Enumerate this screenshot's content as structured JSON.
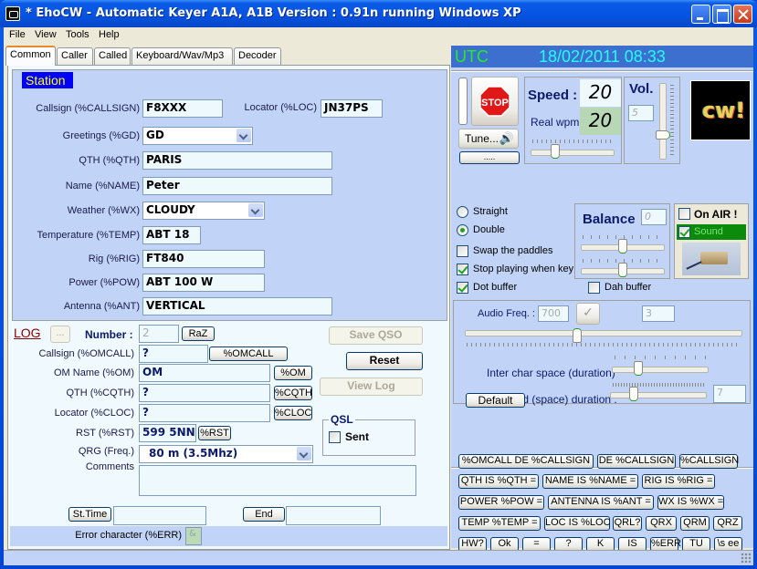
{
  "window": {
    "title": "* EhoCW - Automatic Keyer  A1A, A1B Version : 0.91n  running Windows XP"
  },
  "menu": [
    "File",
    "View",
    "Tools",
    "Help"
  ],
  "tabs": [
    {
      "label": "Common",
      "active": true
    },
    {
      "label": "Caller",
      "active": false
    },
    {
      "label": "Called",
      "active": false
    },
    {
      "label": "Keyboard/Wav/Mp3",
      "active": false
    },
    {
      "label": "Decoder",
      "active": false
    }
  ],
  "station": {
    "title": "Station",
    "callsign": {
      "label": "Callsign (%CALLSIGN)",
      "value": "F8XXX"
    },
    "locator": {
      "label": "Locator (%LOC)",
      "value": "JN37PS"
    },
    "greetings": {
      "label": "Greetings (%GD)",
      "value": "GD"
    },
    "qth": {
      "label": "QTH (%QTH)",
      "value": "PARIS"
    },
    "name": {
      "label": "Name (%NAME)",
      "value": "Peter"
    },
    "weather": {
      "label": "Weather (%WX)",
      "value": "CLOUDY"
    },
    "temperature": {
      "label": "Temperature (%TEMP)",
      "value": "ABT 18"
    },
    "rig": {
      "label": "Rig (%RIG)",
      "value": "FT840"
    },
    "power": {
      "label": "Power (%POW)",
      "value": "ABT 100 W"
    },
    "antenna": {
      "label": "Antenna (%ANT)",
      "value": "VERTICAL"
    }
  },
  "log": {
    "title": "LOG",
    "browse_label": "...",
    "number_label": "Number :",
    "number_value": "2",
    "raz_label": "RaZ",
    "save_qso": "Save QSO",
    "reset": "Reset",
    "view_log": "View Log",
    "callsign": {
      "label": "Callsign  (%OMCALL)",
      "value": "?",
      "button": "%OMCALL"
    },
    "om_name": {
      "label": "OM Name (%OM)",
      "value": "OM",
      "button": "%OM"
    },
    "qth": {
      "label": "QTH (%CQTH)",
      "value": "?",
      "button": "%CQTH"
    },
    "locator": {
      "label": "Locator (%CLOC)",
      "value": "?",
      "button": "%CLOC"
    },
    "rst": {
      "label": "RST (%RST)",
      "value": "599 5NN",
      "button": "%RST"
    },
    "qrg": {
      "label": "QRG (Freq.)",
      "value": "80 m (3.5Mhz)"
    },
    "comments": {
      "label": "Comments",
      "value": ""
    },
    "qsl": {
      "title": "QSL",
      "sent_label": "Sent",
      "sent": false
    },
    "start_time_button": "St.Time",
    "start_time_value": "",
    "end_button": "End",
    "end_value": "",
    "error_char": {
      "label": "Error character (%ERR)",
      "value": "&"
    }
  },
  "clock": {
    "label": "UTC",
    "datetime": "18/02/2011 08:33"
  },
  "keyer": {
    "stop_label": "STOP",
    "tune_label": "Tune...",
    "dots_label": ".....",
    "speed_label": "Speed :",
    "speed_value": "20",
    "real_wpm_label": "Real wpm:",
    "real_wpm_value": "20",
    "speed_slider_fraction": 0.27,
    "vol_label": "Vol.",
    "vol_value": "5",
    "vol_slider_fraction": 0.3,
    "logo_text": "cw!"
  },
  "paddles": {
    "straight_label": "Straight",
    "straight": false,
    "double_label": "Double",
    "double": true,
    "swap_label": "Swap the paddles",
    "swap": false,
    "stop_playing_label": "Stop playing when key",
    "stop_playing": true,
    "dot_buffer_label": "Dot buffer",
    "dot_buffer": true,
    "dah_buffer_label": "Dah buffer",
    "dah_buffer": false
  },
  "balance": {
    "label": "Balance",
    "value": "0",
    "slider1_fraction": 0.5,
    "slider2_fraction": 0.5
  },
  "onair": {
    "on_air_label": "On AIR !",
    "on_air": false,
    "sound_label": "Sound",
    "sound": true
  },
  "audio": {
    "freq_label": "Audio Freq. :",
    "freq_value": "700",
    "extra_value": "3",
    "freq_slider_fraction": 0.4,
    "inter_char_label": "Inter char space (duration)",
    "inter_char_fraction": 0.25,
    "inter_word_label": "Inter-word (space) duration :",
    "inter_word_fraction": 0.22,
    "inter_word_value": "7",
    "default_label": "Default"
  },
  "macros": [
    [
      "%OMCALL DE %CALLSIGN",
      "DE %CALLSIGN",
      "%CALLSIGN"
    ],
    [
      "QTH IS %QTH =",
      "NAME IS %NAME =",
      "RIG IS %RIG ="
    ],
    [
      "POWER %POW =",
      "ANTENNA IS %ANT =",
      "WX IS %WX ="
    ],
    [
      "TEMP %TEMP =",
      "LOC IS %LOC",
      "QRL?",
      "QRX",
      "QRM",
      "QRZ"
    ],
    [
      "HW?",
      "Ok",
      "=",
      "?",
      "K",
      "IS",
      "%ERR",
      "TU",
      "\\s ee"
    ]
  ]
}
